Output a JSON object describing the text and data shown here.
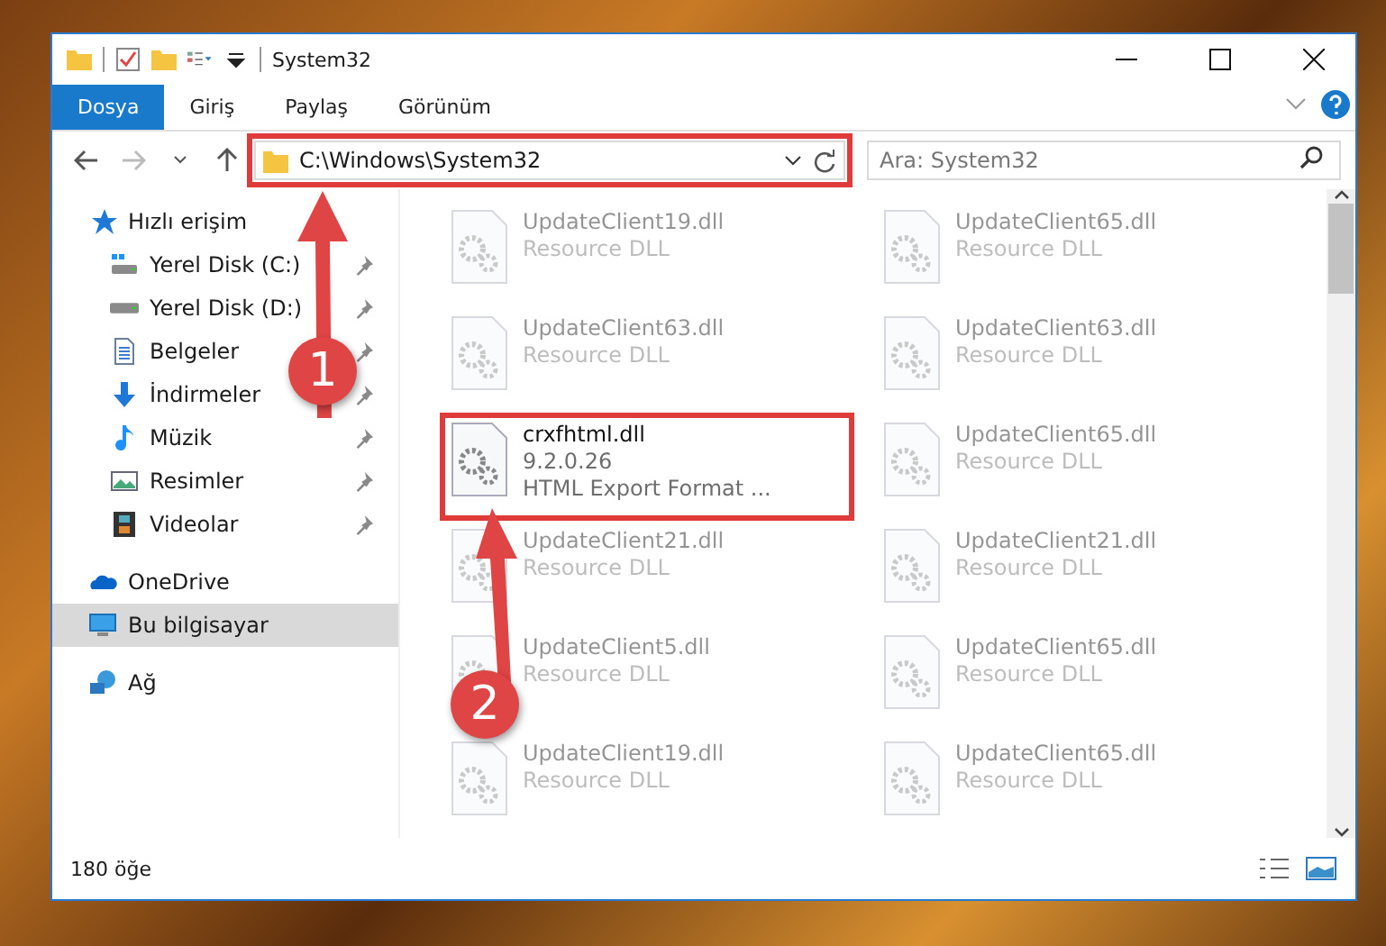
{
  "window": {
    "title": "System32"
  },
  "ribbon_tabs": [
    {
      "label": "Dosya",
      "selected": true
    },
    {
      "label": "Giriş",
      "selected": false
    },
    {
      "label": "Paylaş",
      "selected": false
    },
    {
      "label": "Görünüm",
      "selected": false
    }
  ],
  "address_bar": {
    "path": "C:\\Windows\\System32",
    "highlighted": true
  },
  "search": {
    "placeholder": "Ara: System32"
  },
  "sidebar": {
    "items": [
      {
        "label": "Hızlı erişim",
        "kind": "quick",
        "selected": false,
        "children": [
          {
            "label": "Yerel Disk (C:)",
            "kind": "diskc",
            "pinned": true,
            "selected": false
          },
          {
            "label": "Yerel Disk (D:)",
            "kind": "disk",
            "pinned": true,
            "selected": false
          },
          {
            "label": "Belgeler",
            "kind": "docs",
            "pinned": true,
            "selected": false
          },
          {
            "label": "İndirmeler",
            "kind": "down",
            "pinned": true,
            "selected": false
          },
          {
            "label": "Müzik",
            "kind": "music",
            "pinned": true,
            "selected": false
          },
          {
            "label": "Resimler",
            "kind": "pics",
            "pinned": true,
            "selected": false
          },
          {
            "label": "Videolar",
            "kind": "video",
            "pinned": true,
            "selected": false
          }
        ]
      },
      {
        "label": "OneDrive",
        "kind": "cloud",
        "selected": false
      },
      {
        "label": "Bu bilgisayar",
        "kind": "pc",
        "selected": true
      },
      {
        "label": "Ağ",
        "kind": "net",
        "selected": false
      }
    ]
  },
  "files": [
    {
      "name": "UpdateClient19.dll",
      "lines": [
        "Resource DLL"
      ],
      "highlighted": false
    },
    {
      "name": "UpdateClient65.dll",
      "lines": [
        "Resource DLL"
      ],
      "highlighted": false
    },
    {
      "name": "UpdateClient63.dll",
      "lines": [
        "Resource DLL"
      ],
      "highlighted": false
    },
    {
      "name": "UpdateClient63.dll",
      "lines": [
        "Resource DLL"
      ],
      "highlighted": false
    },
    {
      "name": "crxfhtml.dll",
      "lines": [
        "9.2.0.26",
        "HTML Export Format ..."
      ],
      "highlighted": true
    },
    {
      "name": "UpdateClient65.dll",
      "lines": [
        "Resource DLL"
      ],
      "highlighted": false
    },
    {
      "name": "UpdateClient21.dll",
      "lines": [
        "Resource DLL"
      ],
      "highlighted": false
    },
    {
      "name": "UpdateClient21.dll",
      "lines": [
        "Resource DLL"
      ],
      "highlighted": false
    },
    {
      "name": "UpdateClient5.dll",
      "lines": [
        "Resource DLL"
      ],
      "highlighted": false
    },
    {
      "name": "UpdateClient65.dll",
      "lines": [
        "Resource DLL"
      ],
      "highlighted": false
    },
    {
      "name": "UpdateClient19.dll",
      "lines": [
        "Resource DLL"
      ],
      "highlighted": false
    },
    {
      "name": "UpdateClient65.dll",
      "lines": [
        "Resource DLL"
      ],
      "highlighted": false
    }
  ],
  "status_bar": {
    "count": "180 öğe"
  },
  "annotations": [
    {
      "label": "1"
    },
    {
      "label": "2"
    }
  ]
}
